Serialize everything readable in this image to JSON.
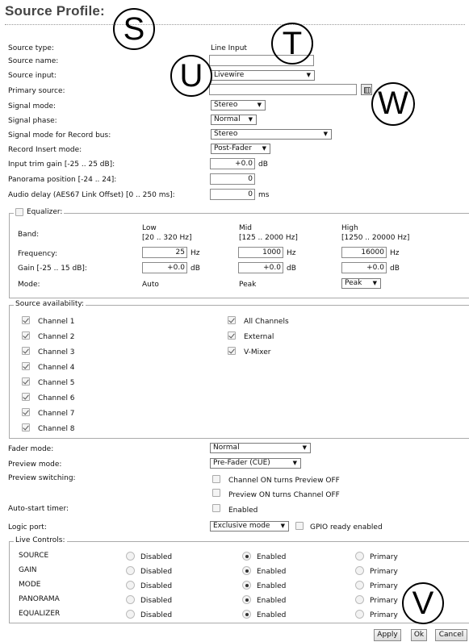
{
  "header": {
    "title": "Source Profile:"
  },
  "annotations": {
    "s": "S",
    "t": "T",
    "u": "U",
    "w": "W",
    "v": "V"
  },
  "fields": {
    "source_type": {
      "label": "Source type:",
      "value": "Line Input"
    },
    "source_name": {
      "label": "Source name:",
      "value": ""
    },
    "source_input": {
      "label": "Source input:",
      "value": "Livewire"
    },
    "primary_source": {
      "label": "Primary source:",
      "value": ""
    },
    "signal_mode": {
      "label": "Signal mode:",
      "value": "Stereo"
    },
    "signal_phase": {
      "label": "Signal phase:",
      "value": "Normal"
    },
    "signal_mode_record": {
      "label": "Signal mode for Record bus:",
      "value": "Stereo"
    },
    "record_insert": {
      "label": "Record Insert mode:",
      "value": "Post-Fader"
    },
    "input_trim": {
      "label": "Input trim gain [-25 .. 25 dB]:",
      "value": "+0.0",
      "unit": "dB"
    },
    "panorama": {
      "label": "Panorama position [-24 .. 24]:",
      "value": "0"
    },
    "audio_delay": {
      "label": "Audio delay (AES67 Link Offset) [0 .. 250 ms]:",
      "value": "0",
      "unit": "ms"
    }
  },
  "equalizer": {
    "legend": "Equalizer:",
    "enabled": false,
    "band_label": "Band:",
    "frequency_label": "Frequency:",
    "gain_label": "Gain [-25 .. 15 dB]:",
    "mode_label": "Mode:",
    "bands": [
      {
        "name": "Low",
        "range": "[20 .. 320 Hz]",
        "frequency": "25",
        "freq_unit": "Hz",
        "gain": "+0.0",
        "gain_unit": "dB",
        "mode": "Auto"
      },
      {
        "name": "Mid",
        "range": "[125 .. 2000 Hz]",
        "frequency": "1000",
        "freq_unit": "Hz",
        "gain": "+0.0",
        "gain_unit": "dB",
        "mode": "Peak"
      },
      {
        "name": "High",
        "range": "[1250 .. 20000 Hz]",
        "frequency": "16000",
        "freq_unit": "Hz",
        "gain": "+0.0",
        "gain_unit": "dB",
        "mode": "Peak"
      }
    ]
  },
  "availability": {
    "legend": "Source availability:",
    "channels": [
      {
        "label": "Channel 1",
        "checked": true
      },
      {
        "label": "Channel 2",
        "checked": true
      },
      {
        "label": "Channel 3",
        "checked": true
      },
      {
        "label": "Channel 4",
        "checked": true
      },
      {
        "label": "Channel 5",
        "checked": true
      },
      {
        "label": "Channel 6",
        "checked": true
      },
      {
        "label": "Channel 7",
        "checked": true
      },
      {
        "label": "Channel 8",
        "checked": true
      }
    ],
    "others": [
      {
        "label": "All Channels",
        "checked": true
      },
      {
        "label": "External",
        "checked": true
      },
      {
        "label": "V-Mixer",
        "checked": true
      }
    ]
  },
  "fader_mode": {
    "label": "Fader mode:",
    "value": "Normal"
  },
  "preview_mode": {
    "label": "Preview mode:",
    "value": "Pre-Fader (CUE)"
  },
  "preview_switching": {
    "label": "Preview switching:",
    "options": [
      "Channel ON turns Preview OFF",
      "Preview ON turns Channel OFF"
    ]
  },
  "auto_start": {
    "label": "Auto-start timer:",
    "option": "Enabled"
  },
  "logic_port": {
    "label": "Logic port:",
    "value": "Exclusive mode",
    "gpio_label": "GPIO ready enabled"
  },
  "live_controls": {
    "legend": "Live Controls:",
    "options": [
      "Disabled",
      "Enabled",
      "Primary"
    ],
    "rows": [
      {
        "name": "SOURCE",
        "selected": 1
      },
      {
        "name": "GAIN",
        "selected": 1
      },
      {
        "name": "MODE",
        "selected": 1
      },
      {
        "name": "PANORAMA",
        "selected": 1
      },
      {
        "name": "EQUALIZER",
        "selected": 1
      }
    ]
  },
  "buttons": {
    "apply": "Apply",
    "ok": "Ok",
    "cancel": "Cancel"
  }
}
